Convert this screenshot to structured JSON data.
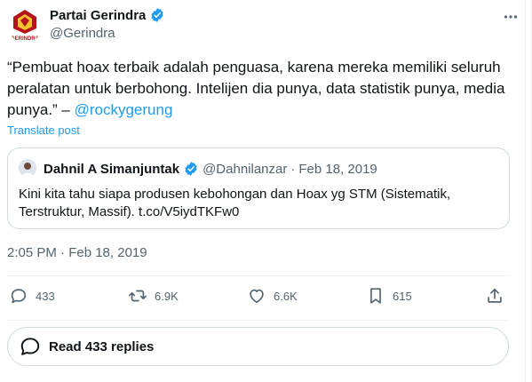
{
  "author": {
    "name": "Partai Gerindra",
    "handle": "@Gerindra",
    "logo_text": "GERINDRA",
    "verified_color": "#1d9bf0"
  },
  "post": {
    "text": "“Pembuat hoax terbaik adalah penguasa, karena mereka memiliki seluruh peralatan untuk berbohong. Intelijen dia punya, data statistik punya, media punya.” – ",
    "mention": "@rockygerung",
    "translate_label": "Translate post",
    "timestamp": "2:05 PM · Feb 18, 2019"
  },
  "quote": {
    "name": "Dahnil A Simanjuntak",
    "handle": "@Dahnilanzar",
    "separator": "·",
    "date": "Feb 18, 2019",
    "text": "Kini kita tahu siapa produsen kebohongan dan Hoax yg STM (Sistematik, Terstruktur, Massif). t.co/V5iydTKFw0"
  },
  "actions": {
    "replies": "433",
    "reposts": "6.9K",
    "likes": "6.6K",
    "bookmarks": "615",
    "icons": [
      "reply-icon",
      "repost-icon",
      "like-icon",
      "bookmark-icon",
      "share-icon"
    ]
  },
  "read_replies_label": "Read 433 replies",
  "colors": {
    "accent": "#1d9bf0",
    "secondary_text": "#536471",
    "border": "#cfd9de",
    "logo_red": "#b5121b"
  }
}
